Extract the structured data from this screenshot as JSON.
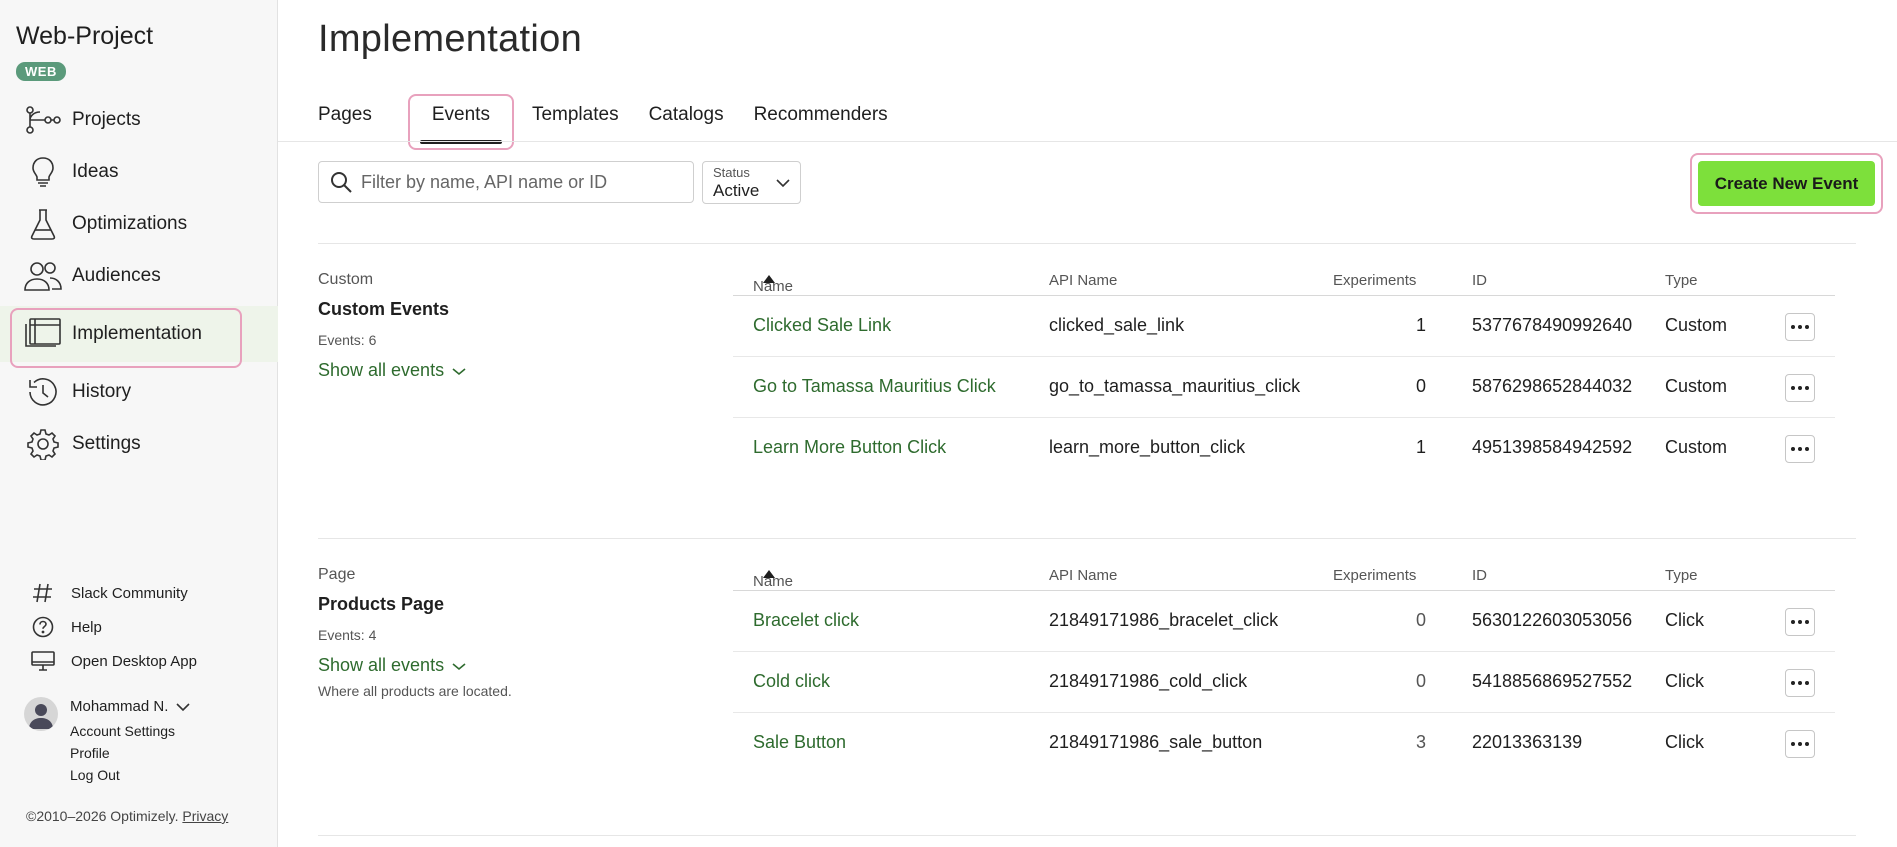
{
  "sidebar": {
    "project_title": "Web-Project",
    "badge": "WEB",
    "nav": [
      {
        "label": "Projects",
        "icon": "projects-icon"
      },
      {
        "label": "Ideas",
        "icon": "lightbulb-icon"
      },
      {
        "label": "Optimizations",
        "icon": "flask-icon"
      },
      {
        "label": "Audiences",
        "icon": "users-icon"
      },
      {
        "label": "Implementation",
        "icon": "window-icon",
        "active": true
      },
      {
        "label": "History",
        "icon": "history-icon"
      },
      {
        "label": "Settings",
        "icon": "gear-icon"
      }
    ],
    "util": [
      {
        "label": "Slack Community",
        "icon": "hash-icon"
      },
      {
        "label": "Help",
        "icon": "help-icon"
      },
      {
        "label": "Open Desktop App",
        "icon": "monitor-icon"
      }
    ],
    "user": {
      "name": "Mohammad N.",
      "links": [
        "Account Settings",
        "Profile",
        "Log Out"
      ]
    },
    "copyright": "©2010–2026 Optimizely.",
    "privacy": "Privacy"
  },
  "main": {
    "title": "Implementation",
    "tabs": [
      "Pages",
      "Events",
      "Templates",
      "Catalogs",
      "Recommenders"
    ],
    "active_tab": "Events",
    "search_placeholder": "Filter by name, API name or ID",
    "status": {
      "label": "Status",
      "value": "Active"
    },
    "create_button": "Create New Event",
    "columns": [
      "Name",
      "API Name",
      "Experiments",
      "ID",
      "Type"
    ],
    "groups": [
      {
        "label": "Custom",
        "title": "Custom Events",
        "count": "Events: 6",
        "show_all": "Show all events",
        "description": "",
        "rows": [
          {
            "name": "Clicked Sale Link",
            "api": "clicked_sale_link",
            "exp": "1",
            "id": "5377678490992640",
            "type": "Custom"
          },
          {
            "name": "Go to Tamassa Mauritius Click",
            "api": "go_to_tamassa_mauritius_click",
            "exp": "0",
            "id": "5876298652844032",
            "type": "Custom"
          },
          {
            "name": "Learn More Button Click",
            "api": "learn_more_button_click",
            "exp": "1",
            "id": "4951398584942592",
            "type": "Custom"
          }
        ]
      },
      {
        "label": "Page",
        "title": "Products Page",
        "count": "Events: 4",
        "show_all": "Show all events",
        "description": "Where all products are located.",
        "rows": [
          {
            "name": "Bracelet click",
            "api": "21849171986_bracelet_click",
            "exp": "0",
            "id": "5630122603053056",
            "type": "Click"
          },
          {
            "name": "Cold click",
            "api": "21849171986_cold_click",
            "exp": "0",
            "id": "5418856869527552",
            "type": "Click"
          },
          {
            "name": "Sale Button",
            "api": "21849171986_sale_button",
            "exp": "3",
            "id": "22013363139",
            "type": "Click"
          }
        ]
      }
    ]
  },
  "colors": {
    "accent_green": "#7de03b",
    "link_green": "#2e6b2e",
    "highlight_pink": "#e8a1bd",
    "badge_green": "#5b9a7b"
  }
}
